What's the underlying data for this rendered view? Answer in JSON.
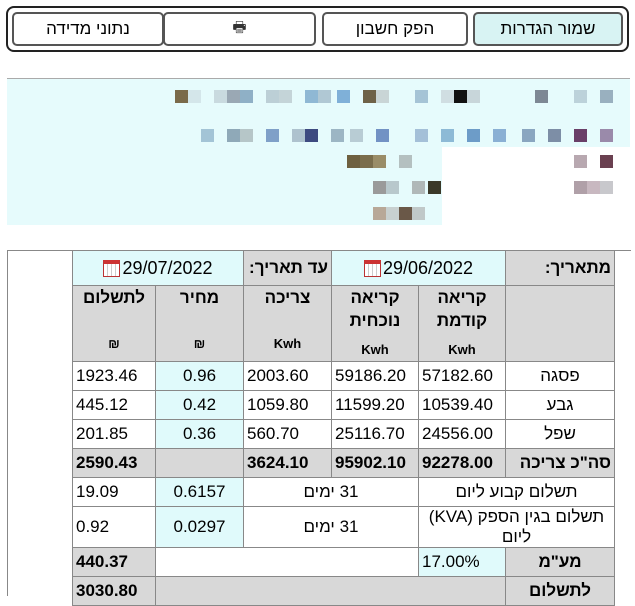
{
  "toolbar": {
    "save_label": "שמור הגדרות",
    "invoice_label": "הפק חשבון",
    "print_icon": "🖶",
    "measure_label": "נתוני מדידה"
  },
  "period": {
    "from_label": "מתאריך:",
    "from_date": "29/06/2022",
    "to_label": "עד תאריך:",
    "to_date": "29/07/2022"
  },
  "headers": {
    "prev": "קריאה קודמת",
    "curr": "קריאה נוכחית",
    "usage": "צריכה",
    "price": "מחיר",
    "pay": "לתשלום",
    "unit_kwh": "Kwh",
    "unit_ils": "₪"
  },
  "rows": [
    {
      "label": "פסגה",
      "prev": "57182.60",
      "curr": "59186.20",
      "usage": "2003.60",
      "price": "0.96",
      "pay": "1923.46"
    },
    {
      "label": "גבע",
      "prev": "10539.40",
      "curr": "11599.20",
      "usage": "1059.80",
      "price": "0.42",
      "pay": "445.12"
    },
    {
      "label": "שפל",
      "prev": "24556.00",
      "curr": "25116.70",
      "usage": "560.70",
      "price": "0.36",
      "pay": "201.85"
    }
  ],
  "total": {
    "label": "סה\"כ צריכה",
    "prev": "92278.00",
    "curr": "95902.10",
    "usage": "3624.10",
    "pay": "2590.43"
  },
  "fixed": {
    "label": "תשלום קבוע ליום",
    "days": "31 ימים",
    "rate": "0.6157",
    "pay": "19.09"
  },
  "kva": {
    "label": "תשלום בגין הספק (KVA) ליום",
    "days": "31 ימים",
    "rate": "0.0297",
    "pay": "0.92"
  },
  "vat": {
    "label": "מע\"מ",
    "rate": "17.00%",
    "pay": "440.37"
  },
  "grand": {
    "label": "לתשלום",
    "pay": "3030.80"
  }
}
